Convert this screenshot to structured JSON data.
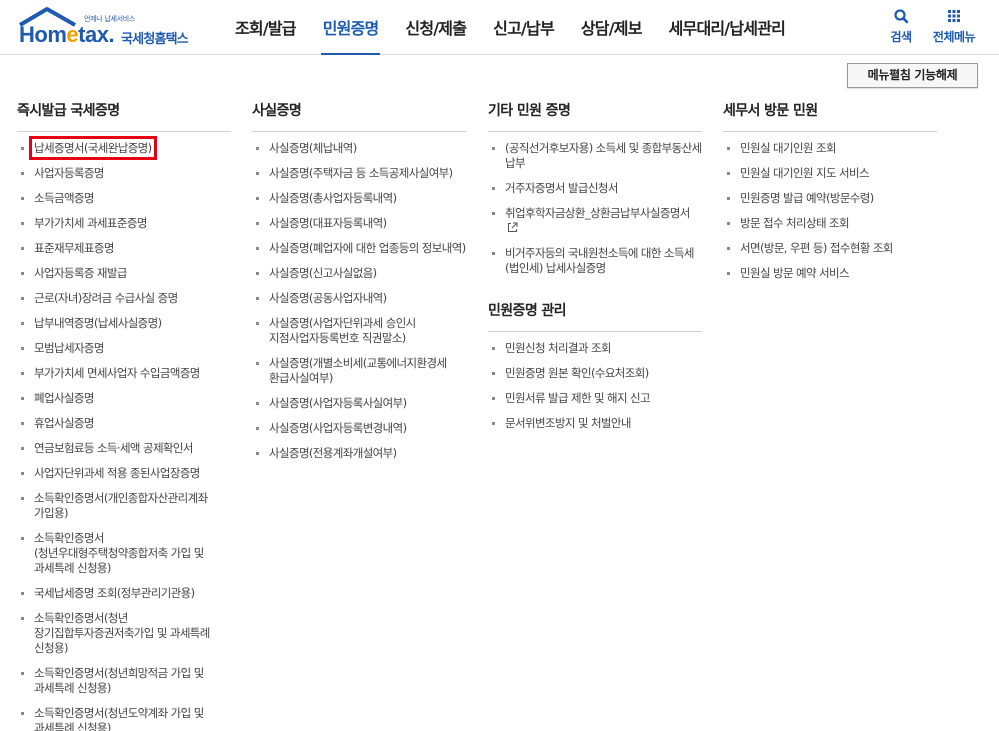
{
  "header": {
    "logo": {
      "tagline": "언제나 납세서비스",
      "brand_prefix": "Hom",
      "brand_e": "e",
      "brand_suffix": "tax.",
      "name": "국세청홈택스"
    },
    "gnb": [
      "조회/발급",
      "민원증명",
      "신청/제출",
      "신고/납부",
      "상담/제보",
      "세무대리/납세관리"
    ],
    "active_gnb": "민원증명",
    "util": {
      "search": "검색",
      "all_menu": "전체메뉴"
    }
  },
  "toolbar": {
    "collapse_label": "메뉴펼침 기능해제"
  },
  "columns": [
    {
      "title": "즉시발급 국세증명",
      "items": [
        "납세증명서(국세완납증명)",
        "사업자등록증명",
        "소득금액증명",
        "부가가치세 과세표준증명",
        "표준재무제표증명",
        "사업자등록증 재발급",
        "근로(자녀)장려금 수급사실 증명",
        "납부내역증명(납세사실증명)",
        "모범납세자증명",
        "부가가치세 면세사업자 수입금액증명",
        "폐업사실증명",
        "휴업사실증명",
        "연금보험료등 소득·세액 공제확인서",
        "사업자단위과세 적용 종된사업장증명",
        "소득확인증명서(개인종합자산관리계좌 가입용)",
        "소득확인증명서(청년우대형주택청약종합저축 가입 및 과세특례 신청용)",
        "국세납세증명 조회(정부관리기관용)",
        "소득확인증명서(청년 장기집합투자증권저축가입 및 과세특례 신청용)",
        "소득확인증명서(청년희망적금 가입 및 과세특례 신청용)",
        "소득확인증명서(청년도약계좌 가입 및 과세특례 신청용)"
      ]
    },
    {
      "title": "사실증명",
      "items": [
        "사실증명(체납내역)",
        "사실증명(주택자금 등 소득공제사실여부)",
        "사실증명(총사업자등록내역)",
        "사실증명(대표자등록내역)",
        "사실증명(폐업자에 대한 업종등의 정보내역)",
        "사실증명(신고사실없음)",
        "사실증명(공동사업자내역)",
        "사실증명(사업자단위과세 승인시 지점사업자등록번호 직권말소)",
        "사실증명(개별소비세(교통에너지환경세 환급사실여부)",
        "사실증명(사업자등록사실여부)",
        "사실증명(사업자등록변경내역)",
        "사실증명(전용계좌개설여부)"
      ]
    },
    {
      "title": "기타 민원 증명",
      "items": [
        "(공직선거후보자용) 소득세 및 종합부동산세 납부",
        "거주자증명서 발급신청서",
        "취업후학자금상환_상환금납부사실증명서",
        "비거주자등의 국내원천소득에 대한 소득세(법인세) 납세사실증명"
      ],
      "sub_title": "민원증명 관리",
      "sub_items": [
        "민원신청 처리결과 조회",
        "민원증명 원본 확인(수요처조회)",
        "민원서류 발급 제한 및 해지 신고",
        "문서위변조방지 및 처벌안내"
      ]
    },
    {
      "title": "세무서 방문 민원",
      "items": [
        "민원실 대기인원 조회",
        "민원실 대기인원 지도 서비스",
        "민원증명 발급 예약(방문수령)",
        "방문 접수 처리상태 조회",
        "서면(방문, 우편 등) 접수현황 조회",
        "민원실 방문 예약 서비스"
      ]
    }
  ],
  "highlighted_item": "납세증명서(국세완납증명)",
  "external_link_item": "취업후학자금상환_상환금납부사실증명서",
  "colors": {
    "brand": "#1d5ab0",
    "accent": "#f4a000",
    "highlight": "#e60012"
  },
  "icons": {
    "search": "search-icon",
    "all_menu": "grid-icon",
    "external": "external-link-icon"
  }
}
